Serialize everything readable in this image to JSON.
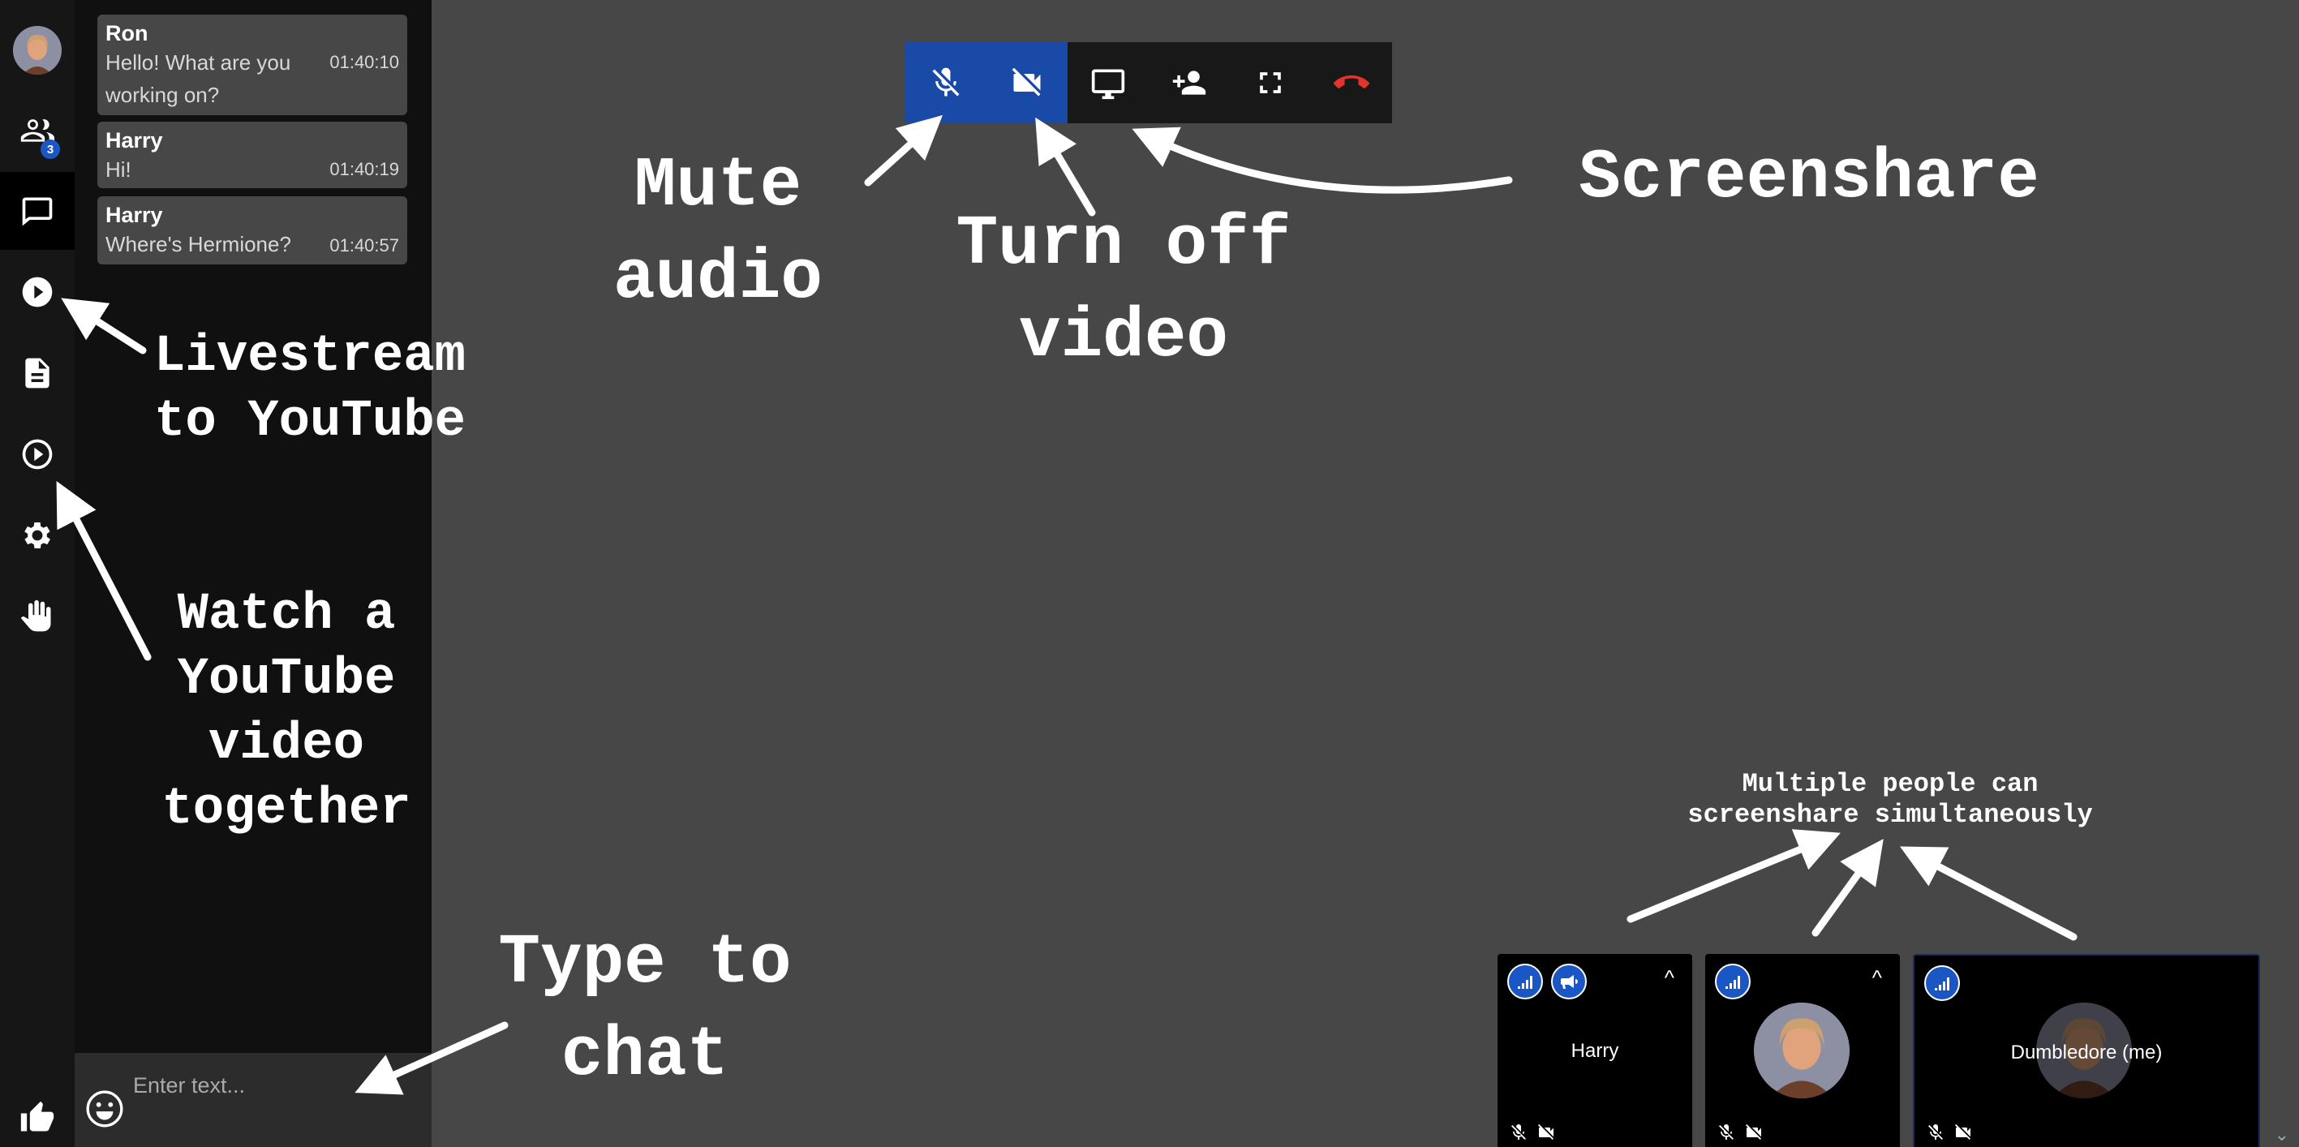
{
  "rail": {
    "participants_badge": "3",
    "items": [
      {
        "name": "avatar"
      },
      {
        "name": "participants-icon"
      },
      {
        "name": "chat-icon"
      },
      {
        "name": "livestream-icon"
      },
      {
        "name": "document-icon"
      },
      {
        "name": "youtube-share-icon"
      },
      {
        "name": "gear-icon"
      },
      {
        "name": "raise-hand-icon"
      },
      {
        "name": "thumbs-up-icon"
      }
    ]
  },
  "chat": {
    "messages": [
      {
        "name": "Ron",
        "text": "Hello! What are you working on?",
        "time": "01:40:10"
      },
      {
        "name": "Harry",
        "text": "Hi!",
        "time": "01:40:19"
      },
      {
        "name": "Harry",
        "text": "Where's Hermione?",
        "time": "01:40:57"
      }
    ],
    "input_placeholder": "Enter text..."
  },
  "toolbar": {
    "buttons": [
      {
        "name": "mute-audio-button",
        "icon": "mic-off-icon",
        "active": true
      },
      {
        "name": "turn-off-video-button",
        "icon": "video-off-icon",
        "active": true
      },
      {
        "name": "screenshare-button",
        "icon": "monitor-icon",
        "active": false
      },
      {
        "name": "invite-button",
        "icon": "add-person-icon",
        "active": false
      },
      {
        "name": "fullscreen-button",
        "icon": "fullscreen-icon",
        "active": false
      },
      {
        "name": "hangup-button",
        "icon": "phone-hangup-icon",
        "active": false,
        "color": "#e0352b"
      }
    ]
  },
  "annotations": {
    "mute_audio": "Mute\naudio",
    "turn_off_video": "Turn off\nvideo",
    "screenshare": "Screenshare",
    "livestream": "Livestream\nto YouTube",
    "watch_youtube": "Watch a\nYouTube\nvideo\ntogether",
    "type_to_chat": "Type to\nchat",
    "multiple_screenshare": "Multiple people can\nscreenshare simultaneously"
  },
  "tiles": [
    {
      "name": "Harry",
      "show_name": true
    },
    {
      "name": "",
      "show_name": false
    },
    {
      "name": "Dumbledore (me)",
      "show_name": true
    }
  ],
  "colors": {
    "accent": "#1a56c4",
    "toolbar_active": "#1a4aa8",
    "hangup": "#e0352b",
    "background": "#474747",
    "chat_bg": "#101010",
    "rail_bg": "#161616"
  }
}
